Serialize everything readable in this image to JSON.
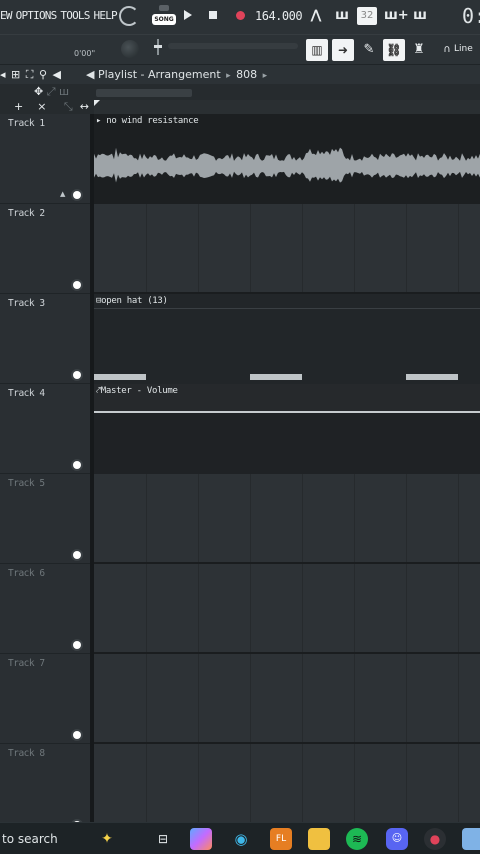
{
  "menu": {
    "view": "EW",
    "options": "OPTIONS",
    "tools": "TOOLS",
    "help": "HELP"
  },
  "transport": {
    "song_toggle_label": "SONG",
    "tempo": "164.000",
    "time_display": "0:",
    "time_label": "0'00\""
  },
  "toolbar": {
    "tool_wave": "32",
    "snap_label": "Line"
  },
  "playlist": {
    "title": "Playlist - Arrangement",
    "pattern": "808"
  },
  "tracks": [
    {
      "name": "Track 1",
      "dim": false
    },
    {
      "name": "Track 2",
      "dim": false
    },
    {
      "name": "Track 3",
      "dim": false
    },
    {
      "name": "Track 4",
      "dim": false
    },
    {
      "name": "Track 5",
      "dim": true
    },
    {
      "name": "Track 6",
      "dim": true
    },
    {
      "name": "Track 7",
      "dim": true
    },
    {
      "name": "Track 8",
      "dim": true
    }
  ],
  "clips": {
    "audio": "no wind resistance",
    "pattern": "open hat (13)",
    "automation": "Master - Volume"
  },
  "taskbar": {
    "search": "to search"
  },
  "colors": {
    "accent_record": "#e0435a",
    "background": "#2d3236"
  }
}
